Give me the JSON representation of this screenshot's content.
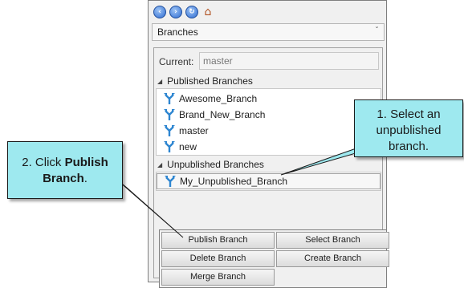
{
  "nav": {
    "icons": [
      "back-icon",
      "forward-icon",
      "refresh-icon",
      "home-icon"
    ]
  },
  "dropdown": {
    "value": "Branches"
  },
  "current": {
    "label": "Current:",
    "value": "master"
  },
  "published": {
    "header": "Published Branches",
    "items": [
      "Awesome_Branch",
      "Brand_New_Branch",
      "master",
      "new"
    ]
  },
  "unpublished": {
    "header": "Unpublished Branches",
    "items": [
      "My_Unpublished_Branch"
    ]
  },
  "buttons": {
    "publish": "Publish Branch",
    "select": "Select Branch",
    "delete": "Delete Branch",
    "create": "Create Branch",
    "merge": "Merge Branch"
  },
  "callouts": {
    "select": "1. Select an unpublished branch.",
    "publish_prefix": "2. Click ",
    "publish_bold": "Publish Branch",
    "publish_suffix": "."
  },
  "colors": {
    "callout_bg": "#9ee9ef",
    "branch_icon": "#2e86d1",
    "panel_bg": "#f0f0f0"
  }
}
